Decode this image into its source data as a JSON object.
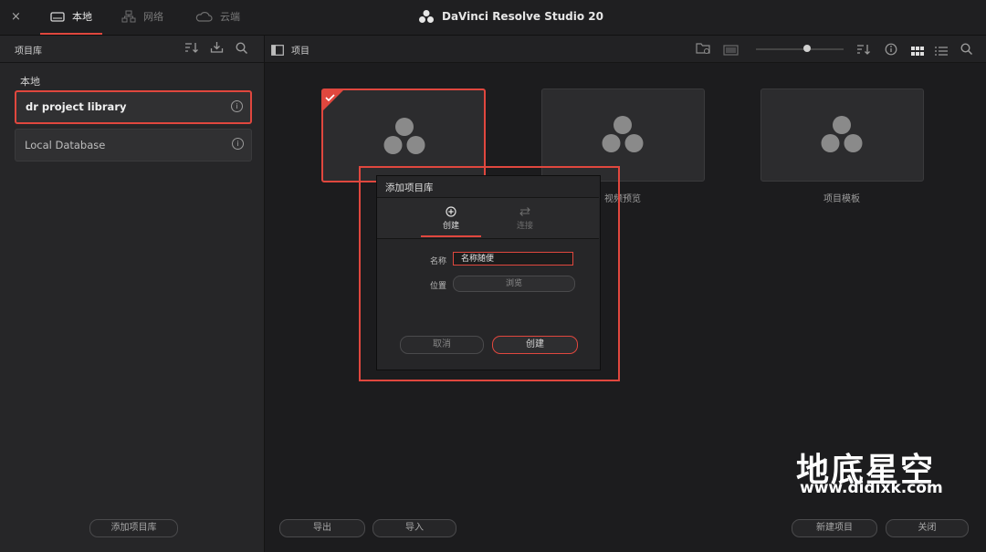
{
  "top_bar": {
    "close_label": "×",
    "tabs": [
      {
        "label": "本地",
        "icon": "drive-icon",
        "active": true
      },
      {
        "label": "网络",
        "icon": "network-icon",
        "active": false
      },
      {
        "label": "云端",
        "icon": "cloud-icon",
        "active": false
      }
    ],
    "app_title": "DaVinci Resolve Studio 20"
  },
  "left_panel": {
    "title": "项目库",
    "section_label": "本地",
    "libraries": [
      {
        "name": "dr project library",
        "selected": true
      },
      {
        "name": "Local Database",
        "selected": false
      }
    ],
    "add_library_label": "添加项目库"
  },
  "right_panel": {
    "title": "项目",
    "thumbnails": [
      {
        "caption": "",
        "selected": true
      },
      {
        "caption": "视频预览",
        "selected": false
      },
      {
        "caption": "项目模板",
        "selected": false
      }
    ],
    "buttons": {
      "export": "导出",
      "import": "导入",
      "new_project": "新建项目",
      "close": "关闭"
    }
  },
  "dialog": {
    "title": "添加项目库",
    "tabs": [
      {
        "label": "创建",
        "icon": "plus-circle-icon",
        "active": true
      },
      {
        "label": "连接",
        "icon": "swap-arrows-icon",
        "active": false
      }
    ],
    "name_label": "名称",
    "name_value": "名称随便",
    "location_label": "位置",
    "browse_label": "浏览",
    "cancel_label": "取消",
    "create_label": "创建"
  },
  "watermark": {
    "title": "地底星空",
    "url": "www.didixk.com"
  },
  "colors": {
    "accent": "#e0473e",
    "background": "#1c1c1e",
    "panel": "#262628"
  }
}
